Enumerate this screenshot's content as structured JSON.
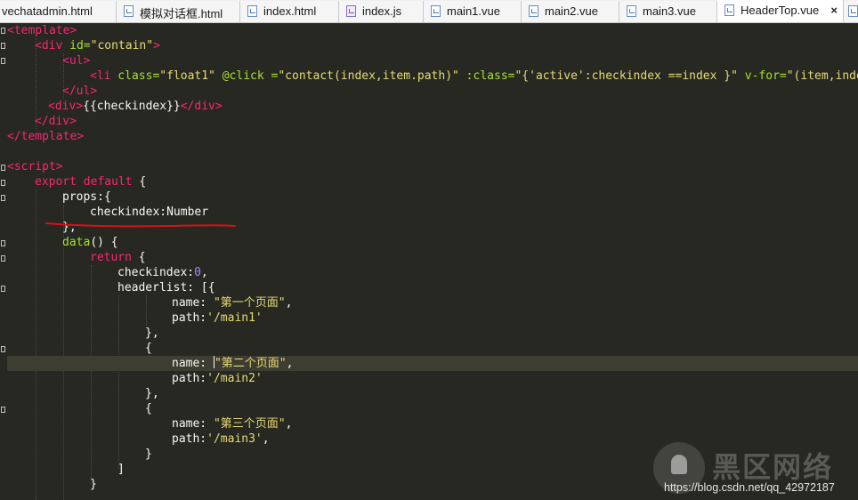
{
  "tabs": [
    {
      "label": "vechatadmin.html",
      "icon": "html-file-icon"
    },
    {
      "label": "模拟对话框.html",
      "icon": "html-file-icon"
    },
    {
      "label": "index.html",
      "icon": "html-file-icon"
    },
    {
      "label": "index.js",
      "icon": "js-file-icon"
    },
    {
      "label": "main1.vue",
      "icon": "vue-file-icon"
    },
    {
      "label": "main2.vue",
      "icon": "vue-file-icon"
    },
    {
      "label": "main3.vue",
      "icon": "vue-file-icon"
    },
    {
      "label": "HeaderTop.vue",
      "icon": "vue-file-icon",
      "active": true
    }
  ],
  "tab_close_glyph": "×",
  "code": {
    "l1": {
      "lt": "<",
      "tag": "template",
      "gt": ">"
    },
    "l2": {
      "lt": "<",
      "tag": "div",
      "attr": " id=",
      "val": "\"contain\"",
      "gt": ">"
    },
    "l3": {
      "lt": "<",
      "tag": "ul",
      "gt": ">"
    },
    "l4": {
      "lt": "<",
      "tag": "li",
      "a1": " class=",
      "v1": "\"float1\"",
      "a2": " @click =",
      "v2": "\"contact(index,item.path)\"",
      "a3": " :class=",
      "v3": "\"{'active':checkindex ==index }\"",
      "a4": " v-for=",
      "v4": "\"(item,index"
    },
    "l5": {
      "lt": "</",
      "tag": "ul",
      "gt": ">"
    },
    "l6": {
      "open": "<",
      "tag": "div",
      "gt": ">",
      "text": "{{checkindex}}",
      "close_lt": "</",
      "close_tag": "div",
      "close_gt": ">"
    },
    "l7": {
      "lt": "</",
      "tag": "div",
      "gt": ">"
    },
    "l8": {
      "lt": "</",
      "tag": "template",
      "gt": ">"
    },
    "l10": {
      "lt": "<",
      "tag": "script",
      "gt": ">"
    },
    "l11": {
      "kw1": "export",
      "kw2": " default",
      "rest": " {"
    },
    "l12": {
      "text": "props:{"
    },
    "l13": {
      "text": "checkindex:Number"
    },
    "l14": {
      "text": "},"
    },
    "l15": {
      "fn": "data",
      "rest": "() {"
    },
    "l16": {
      "kw": "return",
      "rest": " {"
    },
    "l17": {
      "key": "checkindex:",
      "num": "0",
      "rest": ","
    },
    "l18": {
      "text": "headerlist: [{"
    },
    "l19": {
      "key": "name: ",
      "str": "\"第一个页面\"",
      "rest": ","
    },
    "l20": {
      "key": "path:",
      "str": "'/main1'"
    },
    "l21": {
      "text": "},"
    },
    "l22": {
      "text": "{"
    },
    "l23": {
      "key": "name: ",
      "str": "\"第二个页面\"",
      "rest": ","
    },
    "l24": {
      "key": "path:",
      "str": "'/main2'"
    },
    "l25": {
      "text": "},"
    },
    "l26": {
      "text": "{"
    },
    "l27": {
      "key": "name: ",
      "str": "\"第三个页面\"",
      "rest": ","
    },
    "l28": {
      "key": "path:",
      "str": "'/main3'",
      "rest": ","
    },
    "l29": {
      "text": "}"
    },
    "l30": {
      "text": "]"
    },
    "l31": {
      "text": "}"
    }
  },
  "watermark": {
    "brand": "黑区网络",
    "url": "https://blog.csdn.net/qq_42972187"
  },
  "colors": {
    "background": "#272822",
    "tag": "#f92672",
    "attribute": "#a6e22e",
    "string": "#e6db74",
    "number": "#ae81ff",
    "annotation_underline": "#d2141a"
  }
}
